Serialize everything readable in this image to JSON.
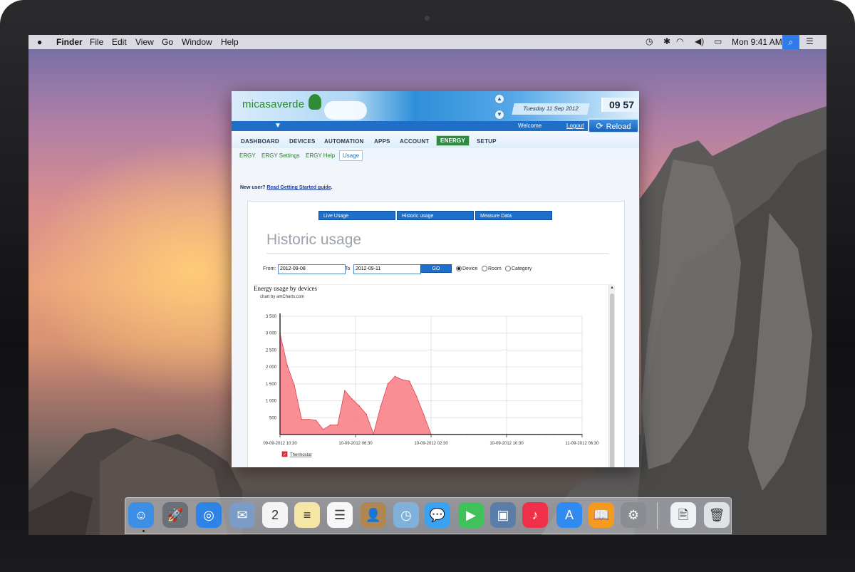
{
  "menubar": {
    "apple_icon": "apple-icon",
    "app_name": "Finder",
    "items": [
      "File",
      "Edit",
      "View",
      "Go",
      "Window",
      "Help"
    ],
    "clock": "Mon 9:41 AM",
    "status_icons": [
      "time-machine-icon",
      "bluetooth-icon",
      "wifi-icon",
      "volume-icon",
      "battery-icon",
      "spotlight-icon",
      "notification-list-icon"
    ]
  },
  "app": {
    "logo_text": "micasaverde",
    "date_text": "Tuesday 11 Sep 2012",
    "time_text": "09 57",
    "welcome": "Welcome",
    "logout": "Logout",
    "reload": "Reload",
    "tabs": [
      "DASHBOARD",
      "DEVICES",
      "AUTOMATION",
      "APPS",
      "ACCOUNT",
      "ENERGY",
      "SETUP"
    ],
    "active_tab": "ENERGY",
    "subtabs": [
      "ERGY",
      "ERGY Settings",
      "ERGY Help",
      "Usage"
    ],
    "active_subtab": "Usage",
    "new_user_prefix": "New user?",
    "new_user_link": "Read Getting Started guide",
    "new_user_suffix": ".",
    "usage_buttons": [
      "Live Usage",
      "Historic usage",
      "Measure Data"
    ],
    "page_title": "Historic usage",
    "filter": {
      "from_label": "From:",
      "from_value": "2012-09-08",
      "to_label": "To",
      "to_value": "2012-09-11",
      "go_label": "GO",
      "options": [
        "Device",
        "Room",
        "Category"
      ],
      "selected": "Device"
    }
  },
  "chart_data": {
    "type": "area",
    "title": "Energy usage by devices",
    "credit": "chart by amCharts.com",
    "xlabel": "",
    "ylabel": "",
    "ylim": [
      0,
      3500
    ],
    "y_ticks": [
      500,
      1000,
      1500,
      2000,
      2500,
      3000,
      3500
    ],
    "y_tick_labels": [
      "500",
      "1 000",
      "1 500",
      "2 000",
      "2 500",
      "3 000",
      "3 500"
    ],
    "x_tick_labels": [
      "09-09-2012 10:30",
      "10-09-2012 06:30",
      "10-09-2012 02:30",
      "10-09-2012 10:30",
      "11-09-2012 06:30"
    ],
    "grid": true,
    "legend_position": "bottom-left",
    "series": [
      {
        "name": "Thermostat",
        "color": "#f87b83",
        "values": [
          3000,
          2050,
          1450,
          450,
          450,
          420,
          150,
          280,
          280,
          1300,
          1050,
          850,
          600,
          20,
          830,
          1500,
          1720,
          1620,
          1580,
          1120,
          580,
          0,
          0,
          0,
          0,
          0,
          0,
          0,
          0,
          0,
          0,
          0,
          0,
          0,
          0,
          0,
          0,
          0,
          0,
          0,
          0,
          0,
          0
        ]
      }
    ]
  },
  "dock": {
    "apps": [
      {
        "name": "finder-icon",
        "bg": "#3d8fe6",
        "glyph": "☺"
      },
      {
        "name": "launchpad-icon",
        "bg": "#6a6f78",
        "glyph": "🚀"
      },
      {
        "name": "safari-icon",
        "bg": "#2e84e6",
        "glyph": "◎"
      },
      {
        "name": "mail-icon",
        "bg": "#7a9cc6",
        "glyph": "✉"
      },
      {
        "name": "calendar-icon",
        "bg": "#f4f4f4",
        "glyph": "2"
      },
      {
        "name": "notes-icon",
        "bg": "#f5e6a6",
        "glyph": "≡"
      },
      {
        "name": "reminders-icon",
        "bg": "#f7f7f7",
        "glyph": "☰"
      },
      {
        "name": "contacts-icon",
        "bg": "#b08752",
        "glyph": "👤"
      },
      {
        "name": "preview-icon",
        "bg": "#7fb1db",
        "glyph": "◷"
      },
      {
        "name": "messages-icon",
        "bg": "#3aa2f0",
        "glyph": "💬"
      },
      {
        "name": "facetime-icon",
        "bg": "#3fc25a",
        "glyph": "▶"
      },
      {
        "name": "iphoto-icon",
        "bg": "#5a7ea8",
        "glyph": "▣"
      },
      {
        "name": "itunes-icon",
        "bg": "#f0304a",
        "glyph": "♪"
      },
      {
        "name": "app-store-icon",
        "bg": "#2f8bf0",
        "glyph": "A"
      },
      {
        "name": "ibooks-icon",
        "bg": "#f39a1f",
        "glyph": "📖"
      },
      {
        "name": "system-preferences-icon",
        "bg": "#8a8d92",
        "glyph": "⚙"
      },
      {
        "name": "document-icon",
        "bg": "#eef2f5",
        "glyph": "🖹"
      },
      {
        "name": "trash-icon",
        "bg": "#dfe3e8",
        "glyph": "🗑"
      }
    ]
  }
}
